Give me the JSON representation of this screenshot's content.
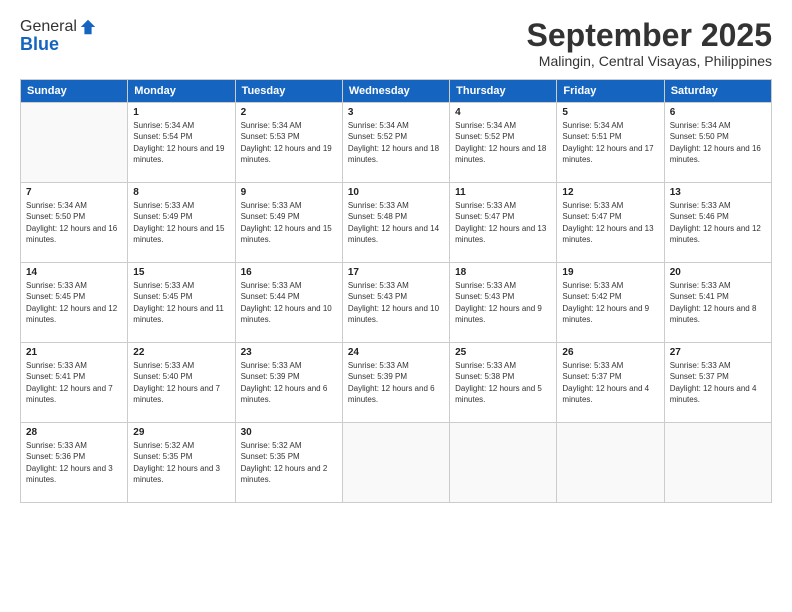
{
  "logo": {
    "general": "General",
    "blue": "Blue"
  },
  "header": {
    "title": "September 2025",
    "location": "Malingin, Central Visayas, Philippines"
  },
  "days_of_week": [
    "Sunday",
    "Monday",
    "Tuesday",
    "Wednesday",
    "Thursday",
    "Friday",
    "Saturday"
  ],
  "weeks": [
    [
      {
        "day": "",
        "info": ""
      },
      {
        "day": "1",
        "sunrise": "5:34 AM",
        "sunset": "5:54 PM",
        "daylight": "12 hours and 19 minutes."
      },
      {
        "day": "2",
        "sunrise": "5:34 AM",
        "sunset": "5:53 PM",
        "daylight": "12 hours and 19 minutes."
      },
      {
        "day": "3",
        "sunrise": "5:34 AM",
        "sunset": "5:52 PM",
        "daylight": "12 hours and 18 minutes."
      },
      {
        "day": "4",
        "sunrise": "5:34 AM",
        "sunset": "5:52 PM",
        "daylight": "12 hours and 18 minutes."
      },
      {
        "day": "5",
        "sunrise": "5:34 AM",
        "sunset": "5:51 PM",
        "daylight": "12 hours and 17 minutes."
      },
      {
        "day": "6",
        "sunrise": "5:34 AM",
        "sunset": "5:50 PM",
        "daylight": "12 hours and 16 minutes."
      }
    ],
    [
      {
        "day": "7",
        "sunrise": "5:34 AM",
        "sunset": "5:50 PM",
        "daylight": "12 hours and 16 minutes."
      },
      {
        "day": "8",
        "sunrise": "5:33 AM",
        "sunset": "5:49 PM",
        "daylight": "12 hours and 15 minutes."
      },
      {
        "day": "9",
        "sunrise": "5:33 AM",
        "sunset": "5:49 PM",
        "daylight": "12 hours and 15 minutes."
      },
      {
        "day": "10",
        "sunrise": "5:33 AM",
        "sunset": "5:48 PM",
        "daylight": "12 hours and 14 minutes."
      },
      {
        "day": "11",
        "sunrise": "5:33 AM",
        "sunset": "5:47 PM",
        "daylight": "12 hours and 13 minutes."
      },
      {
        "day": "12",
        "sunrise": "5:33 AM",
        "sunset": "5:47 PM",
        "daylight": "12 hours and 13 minutes."
      },
      {
        "day": "13",
        "sunrise": "5:33 AM",
        "sunset": "5:46 PM",
        "daylight": "12 hours and 12 minutes."
      }
    ],
    [
      {
        "day": "14",
        "sunrise": "5:33 AM",
        "sunset": "5:45 PM",
        "daylight": "12 hours and 12 minutes."
      },
      {
        "day": "15",
        "sunrise": "5:33 AM",
        "sunset": "5:45 PM",
        "daylight": "12 hours and 11 minutes."
      },
      {
        "day": "16",
        "sunrise": "5:33 AM",
        "sunset": "5:44 PM",
        "daylight": "12 hours and 10 minutes."
      },
      {
        "day": "17",
        "sunrise": "5:33 AM",
        "sunset": "5:43 PM",
        "daylight": "12 hours and 10 minutes."
      },
      {
        "day": "18",
        "sunrise": "5:33 AM",
        "sunset": "5:43 PM",
        "daylight": "12 hours and 9 minutes."
      },
      {
        "day": "19",
        "sunrise": "5:33 AM",
        "sunset": "5:42 PM",
        "daylight": "12 hours and 9 minutes."
      },
      {
        "day": "20",
        "sunrise": "5:33 AM",
        "sunset": "5:41 PM",
        "daylight": "12 hours and 8 minutes."
      }
    ],
    [
      {
        "day": "21",
        "sunrise": "5:33 AM",
        "sunset": "5:41 PM",
        "daylight": "12 hours and 7 minutes."
      },
      {
        "day": "22",
        "sunrise": "5:33 AM",
        "sunset": "5:40 PM",
        "daylight": "12 hours and 7 minutes."
      },
      {
        "day": "23",
        "sunrise": "5:33 AM",
        "sunset": "5:39 PM",
        "daylight": "12 hours and 6 minutes."
      },
      {
        "day": "24",
        "sunrise": "5:33 AM",
        "sunset": "5:39 PM",
        "daylight": "12 hours and 6 minutes."
      },
      {
        "day": "25",
        "sunrise": "5:33 AM",
        "sunset": "5:38 PM",
        "daylight": "12 hours and 5 minutes."
      },
      {
        "day": "26",
        "sunrise": "5:33 AM",
        "sunset": "5:37 PM",
        "daylight": "12 hours and 4 minutes."
      },
      {
        "day": "27",
        "sunrise": "5:33 AM",
        "sunset": "5:37 PM",
        "daylight": "12 hours and 4 minutes."
      }
    ],
    [
      {
        "day": "28",
        "sunrise": "5:33 AM",
        "sunset": "5:36 PM",
        "daylight": "12 hours and 3 minutes."
      },
      {
        "day": "29",
        "sunrise": "5:32 AM",
        "sunset": "5:35 PM",
        "daylight": "12 hours and 3 minutes."
      },
      {
        "day": "30",
        "sunrise": "5:32 AM",
        "sunset": "5:35 PM",
        "daylight": "12 hours and 2 minutes."
      },
      {
        "day": "",
        "info": ""
      },
      {
        "day": "",
        "info": ""
      },
      {
        "day": "",
        "info": ""
      },
      {
        "day": "",
        "info": ""
      }
    ]
  ]
}
